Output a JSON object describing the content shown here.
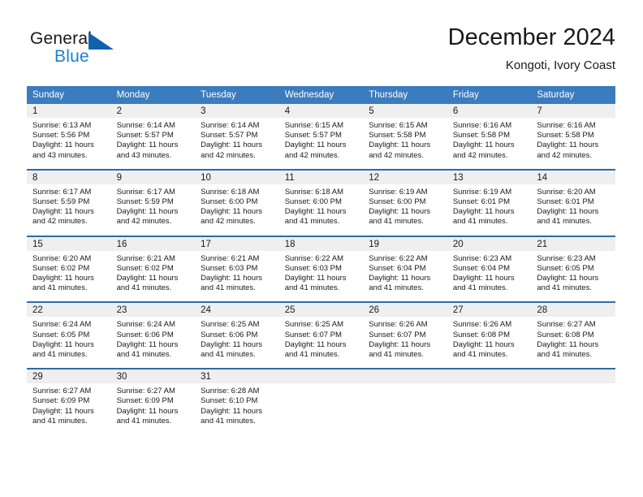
{
  "brand": {
    "name_part1": "General",
    "name_part2": "Blue",
    "accent_color": "#1b7fd4",
    "triangle_color": "#1162ad"
  },
  "header": {
    "title": "December 2024",
    "subtitle": "Kongoti, Ivory Coast"
  },
  "calendar": {
    "header_bg": "#3a7cbd",
    "daynum_bg": "#efefef",
    "row_divider": "#2d6ca8",
    "weekday_headers": [
      "Sunday",
      "Monday",
      "Tuesday",
      "Wednesday",
      "Thursday",
      "Friday",
      "Saturday"
    ],
    "weeks": [
      [
        {
          "day": "1",
          "sunrise": "Sunrise: 6:13 AM",
          "sunset": "Sunset: 5:56 PM",
          "daylight_1": "Daylight: 11 hours",
          "daylight_2": "and 43 minutes."
        },
        {
          "day": "2",
          "sunrise": "Sunrise: 6:14 AM",
          "sunset": "Sunset: 5:57 PM",
          "daylight_1": "Daylight: 11 hours",
          "daylight_2": "and 43 minutes."
        },
        {
          "day": "3",
          "sunrise": "Sunrise: 6:14 AM",
          "sunset": "Sunset: 5:57 PM",
          "daylight_1": "Daylight: 11 hours",
          "daylight_2": "and 42 minutes."
        },
        {
          "day": "4",
          "sunrise": "Sunrise: 6:15 AM",
          "sunset": "Sunset: 5:57 PM",
          "daylight_1": "Daylight: 11 hours",
          "daylight_2": "and 42 minutes."
        },
        {
          "day": "5",
          "sunrise": "Sunrise: 6:15 AM",
          "sunset": "Sunset: 5:58 PM",
          "daylight_1": "Daylight: 11 hours",
          "daylight_2": "and 42 minutes."
        },
        {
          "day": "6",
          "sunrise": "Sunrise: 6:16 AM",
          "sunset": "Sunset: 5:58 PM",
          "daylight_1": "Daylight: 11 hours",
          "daylight_2": "and 42 minutes."
        },
        {
          "day": "7",
          "sunrise": "Sunrise: 6:16 AM",
          "sunset": "Sunset: 5:58 PM",
          "daylight_1": "Daylight: 11 hours",
          "daylight_2": "and 42 minutes."
        }
      ],
      [
        {
          "day": "8",
          "sunrise": "Sunrise: 6:17 AM",
          "sunset": "Sunset: 5:59 PM",
          "daylight_1": "Daylight: 11 hours",
          "daylight_2": "and 42 minutes."
        },
        {
          "day": "9",
          "sunrise": "Sunrise: 6:17 AM",
          "sunset": "Sunset: 5:59 PM",
          "daylight_1": "Daylight: 11 hours",
          "daylight_2": "and 42 minutes."
        },
        {
          "day": "10",
          "sunrise": "Sunrise: 6:18 AM",
          "sunset": "Sunset: 6:00 PM",
          "daylight_1": "Daylight: 11 hours",
          "daylight_2": "and 42 minutes."
        },
        {
          "day": "11",
          "sunrise": "Sunrise: 6:18 AM",
          "sunset": "Sunset: 6:00 PM",
          "daylight_1": "Daylight: 11 hours",
          "daylight_2": "and 41 minutes."
        },
        {
          "day": "12",
          "sunrise": "Sunrise: 6:19 AM",
          "sunset": "Sunset: 6:00 PM",
          "daylight_1": "Daylight: 11 hours",
          "daylight_2": "and 41 minutes."
        },
        {
          "day": "13",
          "sunrise": "Sunrise: 6:19 AM",
          "sunset": "Sunset: 6:01 PM",
          "daylight_1": "Daylight: 11 hours",
          "daylight_2": "and 41 minutes."
        },
        {
          "day": "14",
          "sunrise": "Sunrise: 6:20 AM",
          "sunset": "Sunset: 6:01 PM",
          "daylight_1": "Daylight: 11 hours",
          "daylight_2": "and 41 minutes."
        }
      ],
      [
        {
          "day": "15",
          "sunrise": "Sunrise: 6:20 AM",
          "sunset": "Sunset: 6:02 PM",
          "daylight_1": "Daylight: 11 hours",
          "daylight_2": "and 41 minutes."
        },
        {
          "day": "16",
          "sunrise": "Sunrise: 6:21 AM",
          "sunset": "Sunset: 6:02 PM",
          "daylight_1": "Daylight: 11 hours",
          "daylight_2": "and 41 minutes."
        },
        {
          "day": "17",
          "sunrise": "Sunrise: 6:21 AM",
          "sunset": "Sunset: 6:03 PM",
          "daylight_1": "Daylight: 11 hours",
          "daylight_2": "and 41 minutes."
        },
        {
          "day": "18",
          "sunrise": "Sunrise: 6:22 AM",
          "sunset": "Sunset: 6:03 PM",
          "daylight_1": "Daylight: 11 hours",
          "daylight_2": "and 41 minutes."
        },
        {
          "day": "19",
          "sunrise": "Sunrise: 6:22 AM",
          "sunset": "Sunset: 6:04 PM",
          "daylight_1": "Daylight: 11 hours",
          "daylight_2": "and 41 minutes."
        },
        {
          "day": "20",
          "sunrise": "Sunrise: 6:23 AM",
          "sunset": "Sunset: 6:04 PM",
          "daylight_1": "Daylight: 11 hours",
          "daylight_2": "and 41 minutes."
        },
        {
          "day": "21",
          "sunrise": "Sunrise: 6:23 AM",
          "sunset": "Sunset: 6:05 PM",
          "daylight_1": "Daylight: 11 hours",
          "daylight_2": "and 41 minutes."
        }
      ],
      [
        {
          "day": "22",
          "sunrise": "Sunrise: 6:24 AM",
          "sunset": "Sunset: 6:05 PM",
          "daylight_1": "Daylight: 11 hours",
          "daylight_2": "and 41 minutes."
        },
        {
          "day": "23",
          "sunrise": "Sunrise: 6:24 AM",
          "sunset": "Sunset: 6:06 PM",
          "daylight_1": "Daylight: 11 hours",
          "daylight_2": "and 41 minutes."
        },
        {
          "day": "24",
          "sunrise": "Sunrise: 6:25 AM",
          "sunset": "Sunset: 6:06 PM",
          "daylight_1": "Daylight: 11 hours",
          "daylight_2": "and 41 minutes."
        },
        {
          "day": "25",
          "sunrise": "Sunrise: 6:25 AM",
          "sunset": "Sunset: 6:07 PM",
          "daylight_1": "Daylight: 11 hours",
          "daylight_2": "and 41 minutes."
        },
        {
          "day": "26",
          "sunrise": "Sunrise: 6:26 AM",
          "sunset": "Sunset: 6:07 PM",
          "daylight_1": "Daylight: 11 hours",
          "daylight_2": "and 41 minutes."
        },
        {
          "day": "27",
          "sunrise": "Sunrise: 6:26 AM",
          "sunset": "Sunset: 6:08 PM",
          "daylight_1": "Daylight: 11 hours",
          "daylight_2": "and 41 minutes."
        },
        {
          "day": "28",
          "sunrise": "Sunrise: 6:27 AM",
          "sunset": "Sunset: 6:08 PM",
          "daylight_1": "Daylight: 11 hours",
          "daylight_2": "and 41 minutes."
        }
      ],
      [
        {
          "day": "29",
          "sunrise": "Sunrise: 6:27 AM",
          "sunset": "Sunset: 6:09 PM",
          "daylight_1": "Daylight: 11 hours",
          "daylight_2": "and 41 minutes."
        },
        {
          "day": "30",
          "sunrise": "Sunrise: 6:27 AM",
          "sunset": "Sunset: 6:09 PM",
          "daylight_1": "Daylight: 11 hours",
          "daylight_2": "and 41 minutes."
        },
        {
          "day": "31",
          "sunrise": "Sunrise: 6:28 AM",
          "sunset": "Sunset: 6:10 PM",
          "daylight_1": "Daylight: 11 hours",
          "daylight_2": "and 41 minutes."
        },
        {
          "day": "",
          "sunrise": "",
          "sunset": "",
          "daylight_1": "",
          "daylight_2": ""
        },
        {
          "day": "",
          "sunrise": "",
          "sunset": "",
          "daylight_1": "",
          "daylight_2": ""
        },
        {
          "day": "",
          "sunrise": "",
          "sunset": "",
          "daylight_1": "",
          "daylight_2": ""
        },
        {
          "day": "",
          "sunrise": "",
          "sunset": "",
          "daylight_1": "",
          "daylight_2": ""
        }
      ]
    ]
  }
}
